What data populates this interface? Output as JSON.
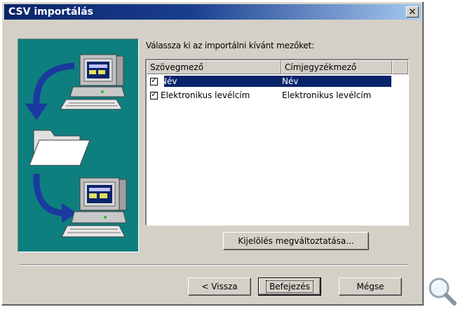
{
  "dialog": {
    "title": "CSV importálás",
    "close_symbol": "✕",
    "instruction": "Válassza ki az importálni kívánt mezőket:"
  },
  "list": {
    "columns": [
      "Szövegmező",
      "Címjegyzékmező",
      ""
    ],
    "rows": [
      {
        "checked": true,
        "field": "Név",
        "mapped": "Név",
        "selected": true,
        "check_symbol": "✓"
      },
      {
        "checked": true,
        "field": "Elektronikus levélcím",
        "mapped": "Elektronikus levélcím",
        "selected": false,
        "check_symbol": "✓"
      }
    ]
  },
  "buttons": {
    "toggle_selection": "Kijelölés megváltoztatása...",
    "back": "< Vissza",
    "finish": "Befejezés",
    "cancel": "Mégse"
  },
  "colors": {
    "titlebar_start": "#0a246a",
    "art_background": "#0e7f7f",
    "selection": "#0a246a"
  },
  "icons": {
    "wizard_art": "computer-folder-transfer-illustration",
    "magnifier": "magnifier-icon"
  }
}
